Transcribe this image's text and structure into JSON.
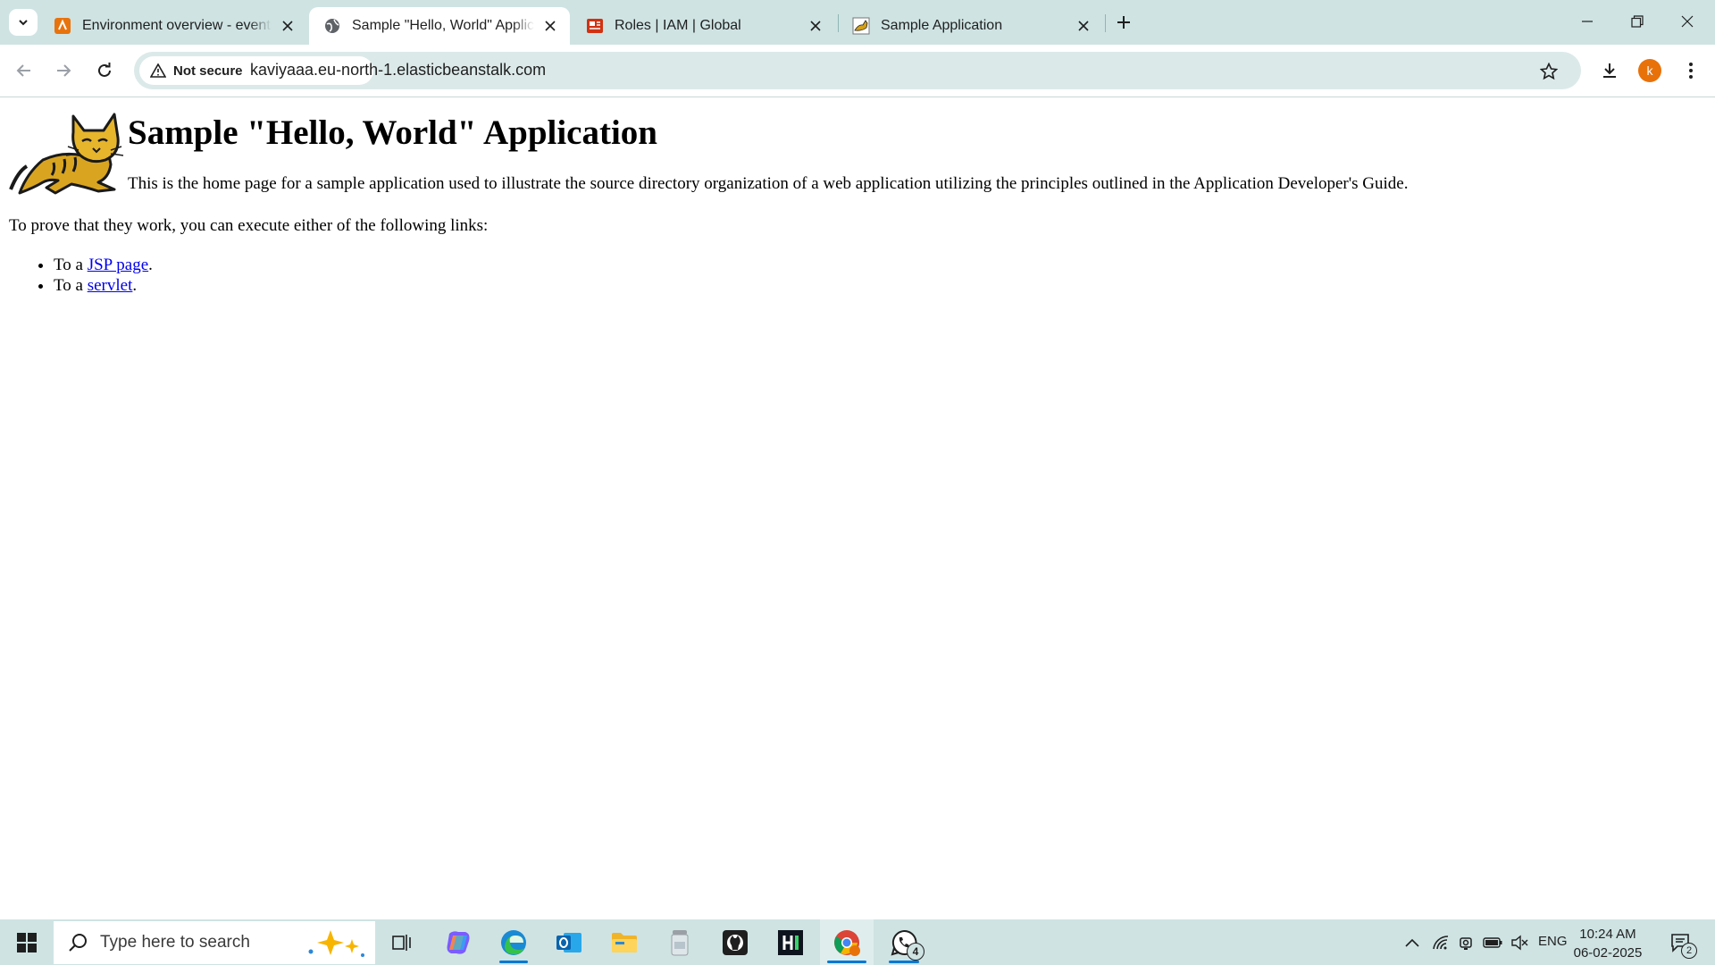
{
  "browser": {
    "tabs": [
      {
        "title": "Environment overview - events",
        "active": false
      },
      {
        "title": "Sample \"Hello, World\" Application",
        "active": true
      },
      {
        "title": "Roles | IAM | Global",
        "active": false
      },
      {
        "title": "Sample Application",
        "active": false
      }
    ],
    "security_label": "Not secure",
    "url": "kaviyaaa.eu-north-1.elasticbeanstalk.com",
    "profile_initial": "k"
  },
  "page": {
    "heading": "Sample \"Hello, World\" Application",
    "intro": "This is the home page for a sample application used to illustrate the source directory organization of a web application utilizing the principles outlined in the Application Developer's Guide.",
    "prove_text": "To prove that they work, you can execute either of the following links:",
    "links": [
      {
        "prefix": "To a ",
        "link": "JSP page",
        "suffix": "."
      },
      {
        "prefix": "To a ",
        "link": "servlet",
        "suffix": "."
      }
    ]
  },
  "taskbar": {
    "search_placeholder": "Type here to search",
    "whatsapp_badge": "4",
    "language": "ENG",
    "time": "10:24 AM",
    "date": "06-02-2025",
    "notification_count": "2"
  },
  "colors": {
    "chrome_frame": "#cfe3e3",
    "omnibox": "#dce9e9",
    "link": "#0000ee",
    "avatar": "#e8710a"
  }
}
